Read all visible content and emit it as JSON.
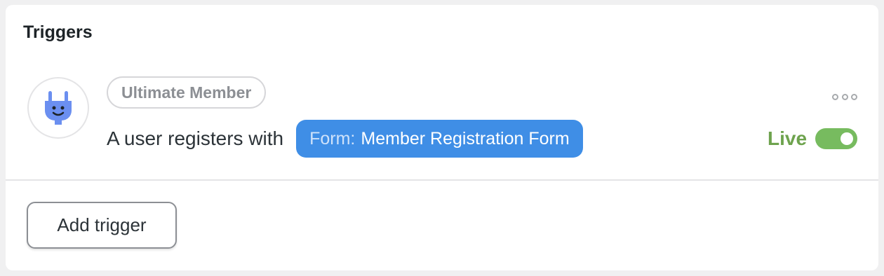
{
  "card": {
    "title": "Triggers"
  },
  "trigger": {
    "integration_icon": "plug-icon",
    "integration_name": "Ultimate Member",
    "sentence": "A user registers with",
    "token_label": "Form:",
    "token_value": "Member Registration Form",
    "more_icon": "more-horizontal-icon",
    "status_label": "Live",
    "status_enabled": true
  },
  "actions": {
    "add_trigger_label": "Add trigger"
  },
  "colors": {
    "token_bg": "#3f8ee6",
    "live_text": "#6ea34e",
    "toggle_on": "#77bb5f",
    "plug_icon": "#6b8ff0"
  }
}
